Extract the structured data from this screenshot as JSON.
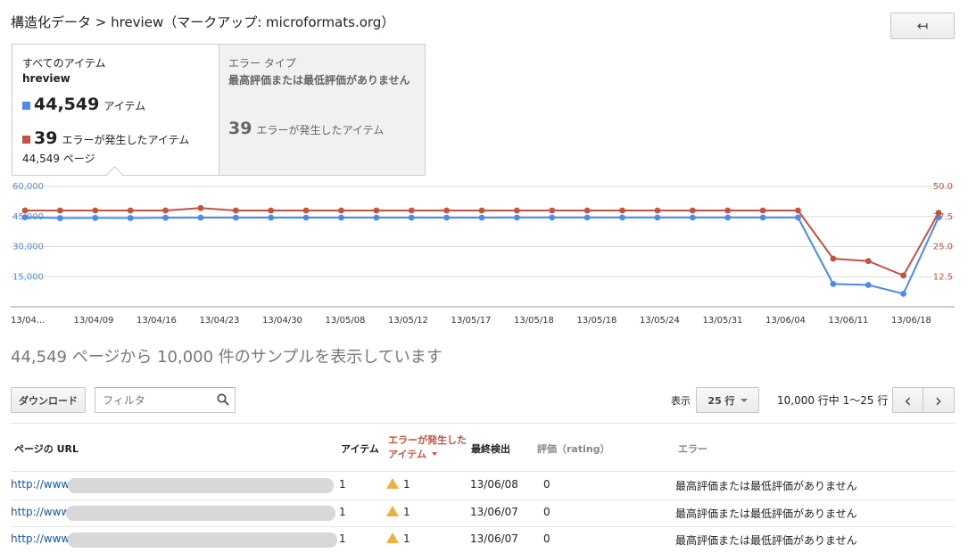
{
  "header": {
    "title": "構造化データ > hreview（マークアップ: microformats.org）",
    "back_icon": "back-arrow-icon",
    "back_symbol": "↤"
  },
  "summary": {
    "left": {
      "heading": "すべてのアイテム",
      "type": "hreview",
      "items_count": "44,549",
      "items_label": "アイテム",
      "errors_count": "39",
      "errors_label": "エラーが発生したアイテム",
      "pages": "44,549 ページ"
    },
    "right": {
      "heading": "エラー タイプ",
      "error_type": "最高評価または最低評価がありません",
      "errors_count": "39",
      "errors_label": "エラーが発生したアイテム"
    }
  },
  "colors": {
    "blue": "#4a8af4",
    "red": "#c5523f"
  },
  "chart_data": {
    "type": "line",
    "x": [
      "13/04/02",
      "13/04/06",
      "13/04/09",
      "13/04/13",
      "13/04/16",
      "13/04/20",
      "13/04/23",
      "13/04/27",
      "13/04/30",
      "13/05/04",
      "13/05/08",
      "13/05/11",
      "13/05/12",
      "13/05/15",
      "13/05/17",
      "13/05/18",
      "13/05/19",
      "13/05/22",
      "13/05/24",
      "13/05/27",
      "13/05/31",
      "13/06/02",
      "13/06/04",
      "13/06/11",
      "13/06/15",
      "13/06/18",
      "13/06/21"
    ],
    "x_tick_labels": [
      "13/04...",
      "13/04/09",
      "13/04/16",
      "13/04/23",
      "13/04/30",
      "13/05/08",
      "13/05/12",
      "13/05/17",
      "13/05/18",
      "13/05/18",
      "13/05/24",
      "13/05/31",
      "13/06/04",
      "13/06/11",
      "13/06/18"
    ],
    "y_left_ticks": [
      "15,000",
      "30,000",
      "45,000",
      "60,000"
    ],
    "y_right_ticks": [
      "12.5",
      "25.0",
      "37.5",
      "50.0"
    ],
    "ylim_left": [
      0,
      60000
    ],
    "ylim_right": [
      0,
      50
    ],
    "grid": true,
    "series": [
      {
        "name": "アイテム",
        "axis": "left",
        "color": "#4a8af4",
        "values": [
          44600,
          44200,
          44300,
          44250,
          44400,
          44450,
          44450,
          44450,
          44450,
          44450,
          44450,
          44450,
          44450,
          44450,
          44500,
          44500,
          44500,
          44500,
          44500,
          44500,
          44500,
          44500,
          44500,
          11400,
          10900,
          6500,
          44549
        ]
      },
      {
        "name": "エラーが発生したアイテム",
        "axis": "right",
        "color": "#c5523f",
        "values": [
          40,
          40,
          40,
          40,
          40,
          41,
          40,
          40,
          40,
          40,
          40,
          40,
          40,
          40,
          40,
          40,
          40,
          40,
          40,
          40,
          40,
          40,
          40,
          20,
          19,
          13,
          39
        ]
      }
    ]
  },
  "sample_text": "44,549 ページから 10,000 件のサンプルを表示しています",
  "toolbar": {
    "download_label": "ダウンロード",
    "filter_placeholder": "フィルタ",
    "display_label": "表示",
    "rows_value": "25 行",
    "range_text": "10,000 行中 1〜25 行",
    "prev": "‹",
    "next": "›"
  },
  "table": {
    "headers": {
      "url": "ページの URL",
      "items": "アイテム",
      "errors_line1": "エラーが発生した",
      "errors_line2": "アイテム",
      "last_detected": "最終検出",
      "rating": "評価（rating）",
      "error": "エラー"
    },
    "rows": [
      {
        "url": "http://www.",
        "items": "1",
        "errors": "1",
        "date": "13/06/08",
        "rating": "0",
        "error": "最高評価または最低評価がありません"
      },
      {
        "url": "http://www",
        "items": "1",
        "errors": "1",
        "date": "13/06/07",
        "rating": "0",
        "error": "最高評価または最低評価がありません"
      },
      {
        "url": "http://www.",
        "items": "1",
        "errors": "1",
        "date": "13/06/07",
        "rating": "0",
        "error": "最高評価または最低評価がありません"
      }
    ]
  }
}
